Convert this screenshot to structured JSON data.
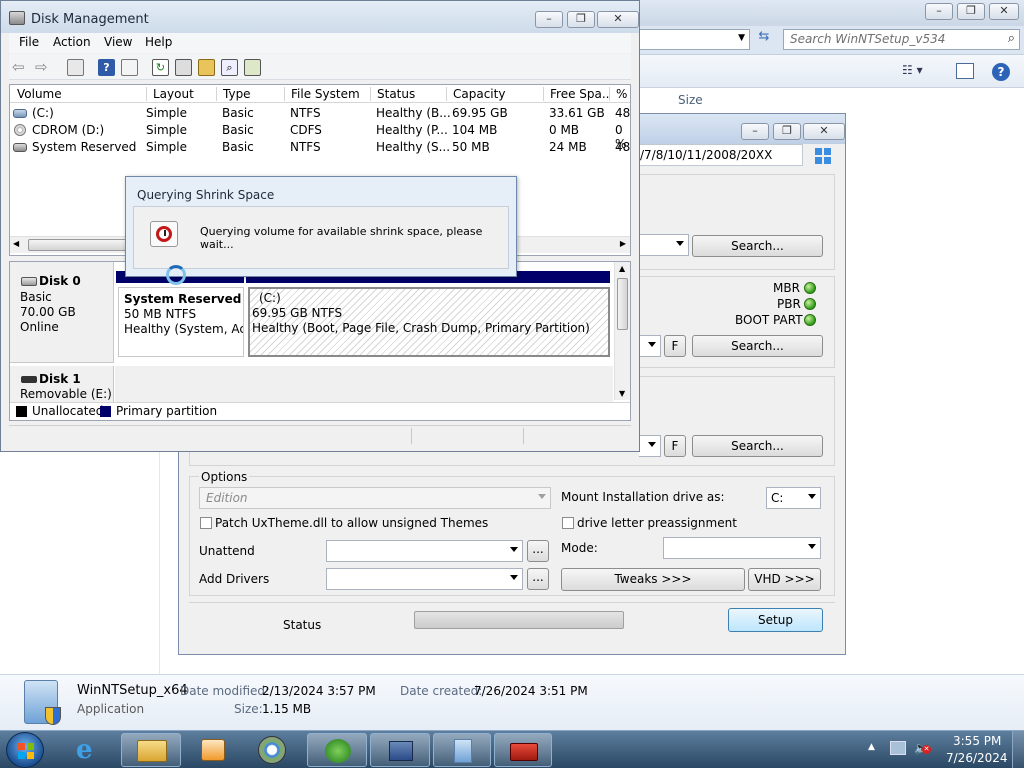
{
  "explorer": {
    "search_placeholder": "Search WinNTSetup_v534",
    "column_size": "Size",
    "details": {
      "file_name": "WinNTSetup_x64",
      "file_type": "Application",
      "date_modified_label": "Date modified:",
      "date_modified_value": "2/13/2024 3:57 PM",
      "date_created_label": "Date created:",
      "date_created_value": "7/26/2024 3:51 PM",
      "size_label": "Size:",
      "size_value": "1.15 MB"
    }
  },
  "winntsetup": {
    "version_text": "/7/8/10/11/2008/20XX",
    "search_label": "Search...",
    "f_label": "F",
    "mbr_label": "MBR",
    "pbr_label": "PBR",
    "boot_part_label": "BOOT PART",
    "options_label": "Options",
    "edition_placeholder": "Edition",
    "patch_uxtheme_label": "Patch UxTheme.dll to allow unsigned Themes",
    "mount_drive_label": "Mount Installation drive as:",
    "mount_drive_value": "C:",
    "drive_letter_label": "drive letter preassignment",
    "unattend_label": "Unattend",
    "mode_label": "Mode:",
    "add_drivers_label": "Add Drivers",
    "ellipsis_label": "...",
    "tweaks_label": "Tweaks >>>",
    "vhd_label": "VHD >>>",
    "status_label": "Status",
    "setup_label": "Setup"
  },
  "disk_management": {
    "title": "Disk Management",
    "menu": [
      "File",
      "Action",
      "View",
      "Help"
    ],
    "columns": [
      "Volume",
      "Layout",
      "Type",
      "File System",
      "Status",
      "Capacity",
      "Free Spa...",
      "% F"
    ],
    "volumes": [
      {
        "volume": "(C:)",
        "layout": "Simple",
        "type": "Basic",
        "fs": "NTFS",
        "status": "Healthy (B...",
        "capacity": "69.95 GB",
        "free": "33.61 GB",
        "pct": "48"
      },
      {
        "volume": "CDROM (D:)",
        "layout": "Simple",
        "type": "Basic",
        "fs": "CDFS",
        "status": "Healthy (P...",
        "capacity": "104 MB",
        "free": "0 MB",
        "pct": "0 %"
      },
      {
        "volume": "System Reserved",
        "layout": "Simple",
        "type": "Basic",
        "fs": "NTFS",
        "status": "Healthy (S...",
        "capacity": "50 MB",
        "free": "24 MB",
        "pct": "48"
      }
    ],
    "disk0": {
      "name": "Disk 0",
      "type": "Basic",
      "size": "70.00 GB",
      "state": "Online"
    },
    "partitions": [
      {
        "name": "System Reserved",
        "size": "50 MB NTFS",
        "status": "Healthy (System, Acti"
      },
      {
        "name": "(C:)",
        "size": "69.95 GB NTFS",
        "status": "Healthy (Boot, Page File, Crash Dump, Primary Partition)"
      }
    ],
    "disk1": {
      "name": "Disk 1",
      "type": "Removable (E:)"
    },
    "legend": {
      "unallocated": "Unallocated",
      "primary": "Primary partition"
    },
    "dialog": {
      "title": "Querying Shrink Space",
      "message": "Querying volume for available shrink space, please wait..."
    }
  },
  "taskbar": {
    "time": "3:55 PM",
    "date": "7/26/2024"
  }
}
